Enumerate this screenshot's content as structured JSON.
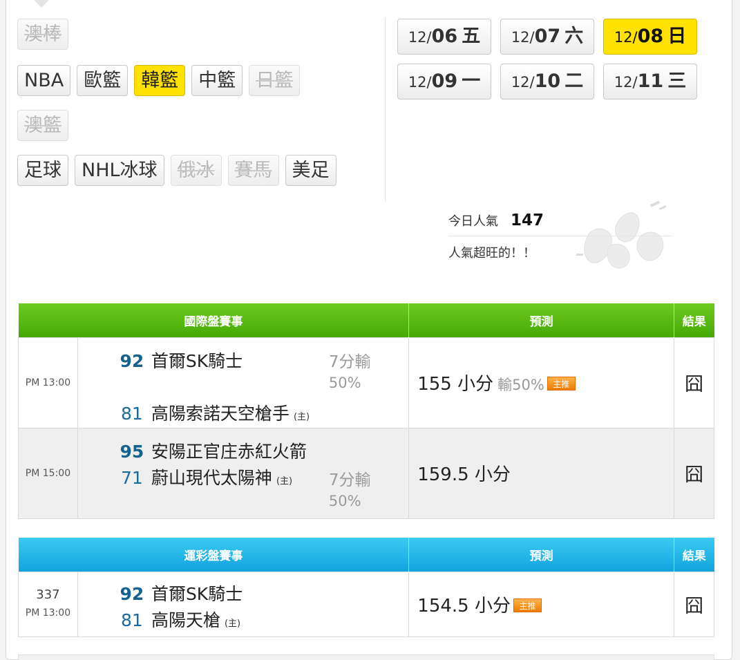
{
  "categories": {
    "row1": [
      {
        "label": "澳棒",
        "state": "disabled"
      }
    ],
    "row2": [
      {
        "label": "NBA",
        "state": "normal"
      },
      {
        "label": "歐籃",
        "state": "normal"
      },
      {
        "label": "韓籃",
        "state": "active"
      },
      {
        "label": "中籃",
        "state": "normal"
      },
      {
        "label": "日籃",
        "state": "disabled"
      }
    ],
    "row3": [
      {
        "label": "澳籃",
        "state": "disabled"
      }
    ],
    "row4": [
      {
        "label": "足球",
        "state": "normal"
      },
      {
        "label": "NHL冰球",
        "state": "normal"
      },
      {
        "label": "俄冰",
        "state": "disabled"
      },
      {
        "label": "賽馬",
        "state": "disabled"
      },
      {
        "label": "美足",
        "state": "normal"
      }
    ]
  },
  "dates": [
    {
      "month": "12/",
      "day": "06",
      "weekday": "五"
    },
    {
      "month": "12/",
      "day": "07",
      "weekday": "六"
    },
    {
      "month": "12/",
      "day": "08",
      "weekday": "日",
      "active": true
    },
    {
      "month": "12/",
      "day": "09",
      "weekday": "一"
    },
    {
      "month": "12/",
      "day": "10",
      "weekday": "二"
    },
    {
      "month": "12/",
      "day": "11",
      "weekday": "三"
    }
  ],
  "popularity": {
    "label": "今日人氣",
    "count": "147",
    "message": "人氣超旺的！！"
  },
  "international": {
    "headers": {
      "event": "國際盤賽事",
      "prediction": "預測",
      "result": "結果"
    },
    "rows": [
      {
        "time": "PM 13:00",
        "away": {
          "score": "92",
          "name": "首爾SK騎士"
        },
        "home": {
          "score": "81",
          "name": "高陽索諾天空槍手",
          "home_mark": "(主)"
        },
        "spread": "7分輸",
        "spread_pct": "50%",
        "prediction": "155 小分",
        "prediction_sub": "輸50%",
        "badge": "主推",
        "result": "囧"
      },
      {
        "time": "PM 15:00",
        "away": {
          "score": "95",
          "name": "安陽正官庄赤紅火箭"
        },
        "home": {
          "score": "71",
          "name": "蔚山現代太陽神",
          "home_mark": "(主)"
        },
        "spread": "7分輸",
        "spread_pct": "50%",
        "prediction": "159.5 小分",
        "result": "囧"
      }
    ]
  },
  "lottery": {
    "headers": {
      "event": "運彩盤賽事",
      "prediction": "預測",
      "result": "結果"
    },
    "rows": [
      {
        "number": "337",
        "time": "PM 13:00",
        "away": {
          "score": "92",
          "name": "首爾SK騎士"
        },
        "home": {
          "score": "81",
          "name": "高陽天槍",
          "home_mark": "(主)"
        },
        "prediction": "154.5 小分",
        "badge": "主推",
        "result": "囧"
      }
    ]
  },
  "colors": {
    "active_yellow": "#ffe200",
    "intl_header": "#52b511",
    "lottery_header": "#1fb3e6",
    "score_blue": "#1a6aa0"
  }
}
